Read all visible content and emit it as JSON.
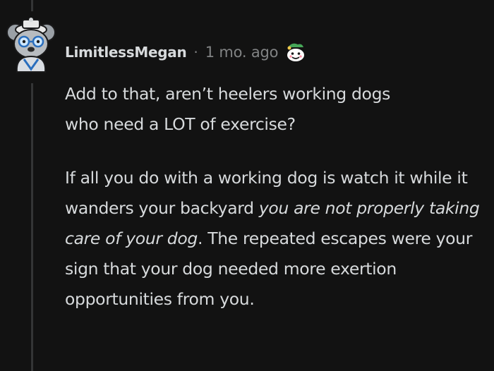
{
  "comment": {
    "author": "LimitlessMegan",
    "separator": "·",
    "timestamp": "1 mo. ago",
    "award_icon": "wholesome-award-icon",
    "avatar_icon": "snoo-avatar-icon",
    "paragraphs": [
      {
        "line1": "Add to that, aren’t heelers working dogs",
        "line2": "who need a LOT of exercise?"
      },
      {
        "pre": "If all you do with a working dog is watch it while it wanders your backyard ",
        "em": "you are not properly taking care of your dog",
        "post": ". The repeated escapes were your sign that your dog needed more exertion opportunities from you."
      }
    ]
  },
  "colors": {
    "background": "#121212",
    "text": "#d7dadc",
    "meta": "#818384",
    "thread_line": "#343536"
  }
}
